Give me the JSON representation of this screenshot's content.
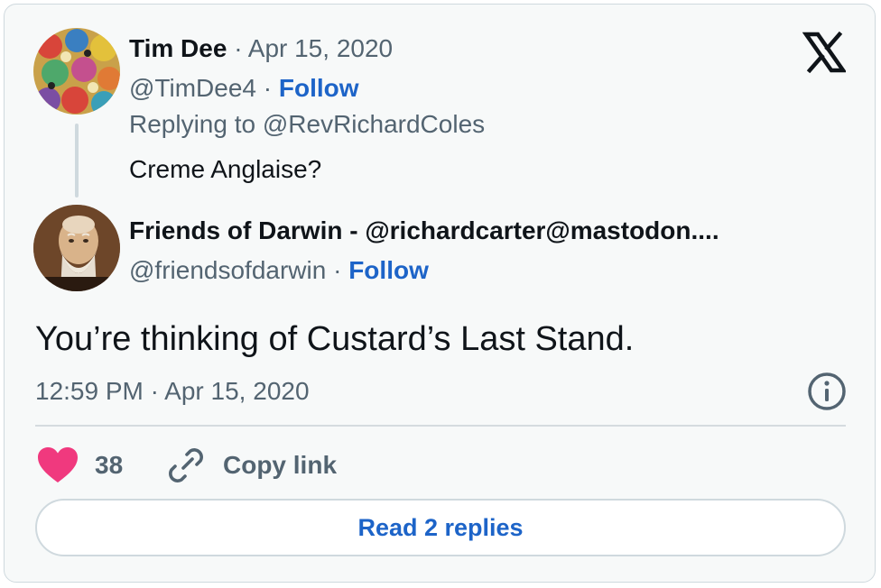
{
  "tweet_parent": {
    "author_name": "Tim Dee",
    "date": "· Apr 15, 2020",
    "handle": "@TimDee4",
    "separator": " · ",
    "follow_label": "Follow",
    "replying_to": "Replying to @RevRichardColes",
    "text": "Creme Anglaise?"
  },
  "tweet_main": {
    "author_name": "Friends of Darwin - @richardcarter@mastodon....",
    "handle": "@friendsofdarwin",
    "separator": " · ",
    "follow_label": "Follow",
    "text": "You’re thinking of Custard’s Last Stand.",
    "timestamp": "12:59 PM · Apr 15, 2020"
  },
  "actions": {
    "like_count": "38",
    "copy_link_label": "Copy link",
    "read_replies_label": "Read 2 replies"
  },
  "icons": {
    "logo": "x-logo-icon",
    "info": "info-icon",
    "like": "heart-icon",
    "copy": "link-icon"
  },
  "colors": {
    "link_blue": "#1d64c8",
    "heart_pink": "#f0397e",
    "muted_text": "#536471",
    "card_background": "#f7f9f9"
  }
}
